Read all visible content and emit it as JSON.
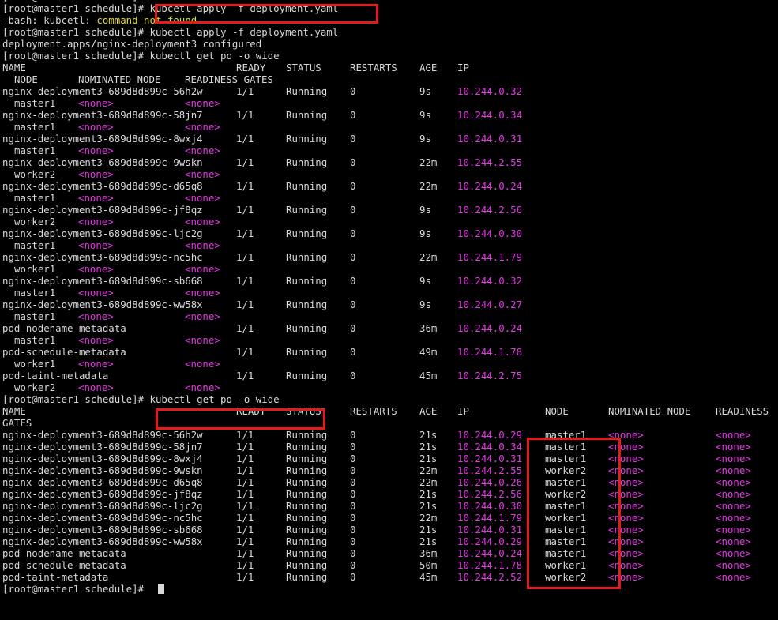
{
  "terminal": {
    "prompt": "[root@master1 schedule]#",
    "first_line": "[root@master1 schedule]#",
    "cmd1": " kubcetl apply -f deployment.yaml",
    "err_prefix": "-bash: kubcetl: ",
    "err_msg": "command not found",
    "cmd2": " kubectl apply -f deployment.yaml",
    "applied_msg": "deployment.apps/nginx-deployment3 configured",
    "cmd3": " kubectl get po -o wide",
    "cmd4": " kubectl get po -o wide",
    "first_table": {
      "header1": [
        "NAME",
        "READY",
        "STATUS",
        "RESTARTS",
        "AGE",
        "IP"
      ],
      "header2": [
        "NODE",
        "NOMINATED NODE",
        "READINESS GATES"
      ],
      "rows": [
        {
          "name": "nginx-deployment3-689d8d899c-56h2w",
          "ready": "1/1",
          "status": "Running",
          "restarts": "0",
          "age": "9s",
          "ip": "10.244.0.32",
          "node": "master1",
          "nominated": "<none>",
          "readiness": "<none>"
        },
        {
          "name": "nginx-deployment3-689d8d899c-58jn7",
          "ready": "1/1",
          "status": "Running",
          "restarts": "0",
          "age": "9s",
          "ip": "10.244.0.34",
          "node": "master1",
          "nominated": "<none>",
          "readiness": "<none>"
        },
        {
          "name": "nginx-deployment3-689d8d899c-8wxj4",
          "ready": "1/1",
          "status": "Running",
          "restarts": "0",
          "age": "9s",
          "ip": "10.244.0.31",
          "node": "master1",
          "nominated": "<none>",
          "readiness": "<none>"
        },
        {
          "name": "nginx-deployment3-689d8d899c-9wskn",
          "ready": "1/1",
          "status": "Running",
          "restarts": "0",
          "age": "22m",
          "ip": "10.244.2.55",
          "node": "worker2",
          "nominated": "<none>",
          "readiness": "<none>"
        },
        {
          "name": "nginx-deployment3-689d8d899c-d65q8",
          "ready": "1/1",
          "status": "Running",
          "restarts": "0",
          "age": "22m",
          "ip": "10.244.0.24",
          "node": "master1",
          "nominated": "<none>",
          "readiness": "<none>"
        },
        {
          "name": "nginx-deployment3-689d8d899c-jf8qz",
          "ready": "1/1",
          "status": "Running",
          "restarts": "0",
          "age": "9s",
          "ip": "10.244.2.56",
          "node": "worker2",
          "nominated": "<none>",
          "readiness": "<none>"
        },
        {
          "name": "nginx-deployment3-689d8d899c-ljc2g",
          "ready": "1/1",
          "status": "Running",
          "restarts": "0",
          "age": "9s",
          "ip": "10.244.0.30",
          "node": "master1",
          "nominated": "<none>",
          "readiness": "<none>"
        },
        {
          "name": "nginx-deployment3-689d8d899c-nc5hc",
          "ready": "1/1",
          "status": "Running",
          "restarts": "0",
          "age": "22m",
          "ip": "10.244.1.79",
          "node": "worker1",
          "nominated": "<none>",
          "readiness": "<none>"
        },
        {
          "name": "nginx-deployment3-689d8d899c-sb668",
          "ready": "1/1",
          "status": "Running",
          "restarts": "0",
          "age": "9s",
          "ip": "10.244.0.32",
          "node": "master1",
          "nominated": "<none>",
          "readiness": "<none>"
        },
        {
          "name": "nginx-deployment3-689d8d899c-ww58x",
          "ready": "1/1",
          "status": "Running",
          "restarts": "0",
          "age": "9s",
          "ip": "10.244.0.27",
          "node": "master1",
          "nominated": "<none>",
          "readiness": "<none>"
        },
        {
          "name": "pod-nodename-metadata",
          "ready": "1/1",
          "status": "Running",
          "restarts": "0",
          "age": "36m",
          "ip": "10.244.0.24",
          "node": "master1",
          "nominated": "<none>",
          "readiness": "<none>"
        },
        {
          "name": "pod-schedule-metadata",
          "ready": "1/1",
          "status": "Running",
          "restarts": "0",
          "age": "49m",
          "ip": "10.244.1.78",
          "node": "worker1",
          "nominated": "<none>",
          "readiness": "<none>"
        },
        {
          "name": "pod-taint-metadata",
          "ready": "1/1",
          "status": "Running",
          "restarts": "0",
          "age": "45m",
          "ip": "10.244.2.75",
          "node": "worker2",
          "nominated": "<none>",
          "readiness": "<none>"
        }
      ]
    },
    "second_table": {
      "header1": [
        "NAME",
        "READY",
        "STATUS",
        "RESTARTS",
        "AGE",
        "IP",
        "NODE",
        "NOMINATED NODE",
        "READINESS"
      ],
      "header2": "GATES",
      "rows": [
        {
          "name": "nginx-deployment3-689d8d899c-56h2w",
          "ready": "1/1",
          "status": "Running",
          "restarts": "0",
          "age": "21s",
          "ip": "10.244.0.29",
          "node": "master1",
          "nominated": "<none>",
          "readiness": "<none>"
        },
        {
          "name": "nginx-deployment3-689d8d899c-58jn7",
          "ready": "1/1",
          "status": "Running",
          "restarts": "0",
          "age": "21s",
          "ip": "10.244.0.34",
          "node": "master1",
          "nominated": "<none>",
          "readiness": "<none>"
        },
        {
          "name": "nginx-deployment3-689d8d899c-8wxj4",
          "ready": "1/1",
          "status": "Running",
          "restarts": "0",
          "age": "21s",
          "ip": "10.244.0.31",
          "node": "master1",
          "nominated": "<none>",
          "readiness": "<none>"
        },
        {
          "name": "nginx-deployment3-689d8d899c-9wskn",
          "ready": "1/1",
          "status": "Running",
          "restarts": "0",
          "age": "22m",
          "ip": "10.244.2.55",
          "node": "worker2",
          "nominated": "<none>",
          "readiness": "<none>"
        },
        {
          "name": "nginx-deployment3-689d8d899c-d65q8",
          "ready": "1/1",
          "status": "Running",
          "restarts": "0",
          "age": "22m",
          "ip": "10.244.0.26",
          "node": "master1",
          "nominated": "<none>",
          "readiness": "<none>"
        },
        {
          "name": "nginx-deployment3-689d8d899c-jf8qz",
          "ready": "1/1",
          "status": "Running",
          "restarts": "0",
          "age": "21s",
          "ip": "10.244.2.56",
          "node": "worker2",
          "nominated": "<none>",
          "readiness": "<none>"
        },
        {
          "name": "nginx-deployment3-689d8d899c-ljc2g",
          "ready": "1/1",
          "status": "Running",
          "restarts": "0",
          "age": "21s",
          "ip": "10.244.0.30",
          "node": "master1",
          "nominated": "<none>",
          "readiness": "<none>"
        },
        {
          "name": "nginx-deployment3-689d8d899c-nc5hc",
          "ready": "1/1",
          "status": "Running",
          "restarts": "0",
          "age": "22m",
          "ip": "10.244.1.79",
          "node": "worker1",
          "nominated": "<none>",
          "readiness": "<none>"
        },
        {
          "name": "nginx-deployment3-689d8d899c-sb668",
          "ready": "1/1",
          "status": "Running",
          "restarts": "0",
          "age": "21s",
          "ip": "10.244.0.31",
          "node": "master1",
          "nominated": "<none>",
          "readiness": "<none>"
        },
        {
          "name": "nginx-deployment3-689d8d899c-ww58x",
          "ready": "1/1",
          "status": "Running",
          "restarts": "0",
          "age": "21s",
          "ip": "10.244.0.29",
          "node": "master1",
          "nominated": "<none>",
          "readiness": "<none>"
        },
        {
          "name": "pod-nodename-metadata",
          "ready": "1/1",
          "status": "Running",
          "restarts": "0",
          "age": "36m",
          "ip": "10.244.0.24",
          "node": "master1",
          "nominated": "<none>",
          "readiness": "<none>"
        },
        {
          "name": "pod-schedule-metadata",
          "ready": "1/1",
          "status": "Running",
          "restarts": "0",
          "age": "50m",
          "ip": "10.244.1.78",
          "node": "worker1",
          "nominated": "<none>",
          "readiness": "<none>"
        },
        {
          "name": "pod-taint-metadata",
          "ready": "1/1",
          "status": "Running",
          "restarts": "0",
          "age": "45m",
          "ip": "10.244.2.52",
          "node": "worker2",
          "nominated": "<none>",
          "readiness": "<none>"
        }
      ]
    }
  },
  "colors": {
    "background": "#000000",
    "text": "#d8d8d8",
    "ip": "#e339e3",
    "none_tag": "#e339e3",
    "error": "#e1d830",
    "highlight_box": "#e31b1b"
  }
}
